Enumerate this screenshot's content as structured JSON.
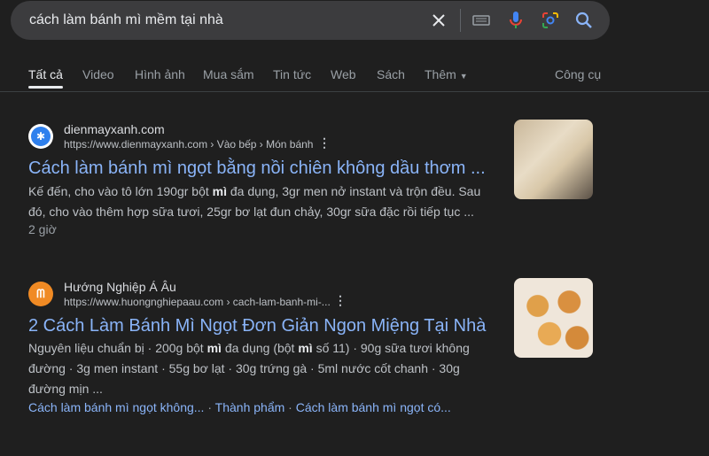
{
  "search": {
    "query": "cách làm bánh mì mềm tại nhà"
  },
  "tabs": [
    "Tất cả",
    "Video",
    "Hình ảnh",
    "Mua sắm",
    "Tin tức",
    "Web",
    "Sách",
    "Thêm"
  ],
  "tools": "Công cụ",
  "results": [
    {
      "site": "dienmayxanh.com",
      "url": "https://www.dienmayxanh.com › Vào bếp › Món bánh",
      "title": "Cách làm bánh mì ngọt bằng nồi chiên không dầu thơm ...",
      "snippet": [
        {
          "t": "Kế đến, cho vào tô lớn 190gr bột "
        },
        {
          "t": "mì",
          "b": true
        },
        {
          "t": " đa dụng, 3gr men nở instant và trộn đều. Sau đó, cho vào thêm hợp sữa tươi, 25gr bơ lạt đun chảy, 30gr sữa đặc rồi tiếp tục ..."
        }
      ],
      "time": "2 giờ"
    },
    {
      "site": "Hướng Nghiệp Á Âu",
      "url": "https://www.huongnghiepaau.com › cach-lam-banh-mi-...",
      "title": "2 Cách Làm Bánh Mì Ngọt Đơn Giản Ngon Miệng Tại Nhà",
      "snippet": [
        {
          "t": "Nguyên liệu chuẩn bị · 200g bột "
        },
        {
          "t": "mì",
          "b": true
        },
        {
          "t": " đa dụng (bột "
        },
        {
          "t": "mì",
          "b": true
        },
        {
          "t": " số 11) · 90g sữa tươi không đường · 3g men instant · 55g bơ lạt · 30g trứng gà · 5ml nước cốt chanh · 30g đường mịn ..."
        }
      ],
      "links": [
        "Cách làm bánh mì ngọt không...",
        "Thành phẩm",
        "Cách làm bánh mì ngọt có..."
      ]
    }
  ],
  "colors": {
    "background": "#1f1f1f",
    "link": "#8ab4f8",
    "searchbar": "#3c3c3e"
  }
}
